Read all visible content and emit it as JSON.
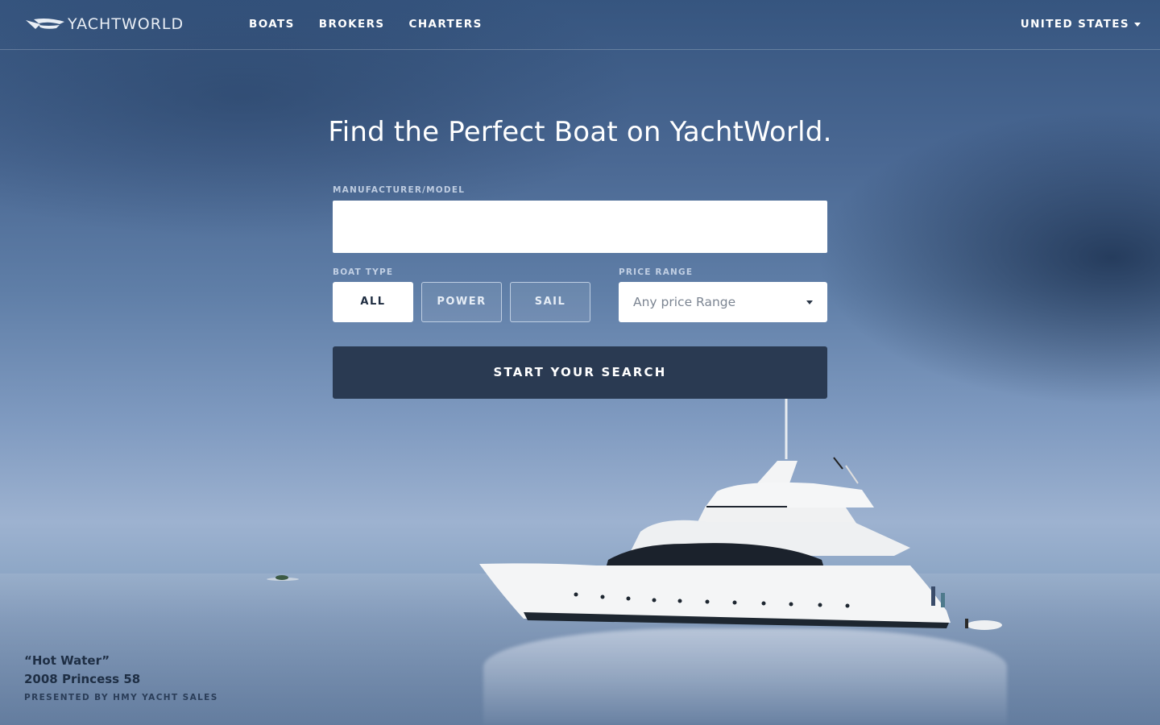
{
  "header": {
    "logo_text": "YACHTWORLD",
    "nav": [
      {
        "label": "BOATS"
      },
      {
        "label": "BROKERS"
      },
      {
        "label": "CHARTERS"
      }
    ],
    "region": "UNITED STATES"
  },
  "hero": {
    "headline": "Find the Perfect Boat on YachtWorld."
  },
  "search": {
    "manufacturer_label": "MANUFACTURER/MODEL",
    "manufacturer_value": "",
    "boat_type_label": "BOAT TYPE",
    "boat_types": [
      {
        "label": "ALL",
        "selected": true
      },
      {
        "label": "POWER",
        "selected": false
      },
      {
        "label": "SAIL",
        "selected": false
      }
    ],
    "price_label": "PRICE RANGE",
    "price_value": "Any price Range",
    "submit_label": "START YOUR SEARCH"
  },
  "credit": {
    "name": "“Hot Water”",
    "model": "2008 Princess 58",
    "presented_by": "PRESENTED BY HMY YACHT SALES"
  },
  "colors": {
    "search_button": "#2a3a52",
    "sky_top": "#36557f",
    "text_white": "#ffffff"
  },
  "icons": [
    "yachtworld-logo-icon",
    "chevron-down-icon",
    "chevron-down-icon"
  ]
}
